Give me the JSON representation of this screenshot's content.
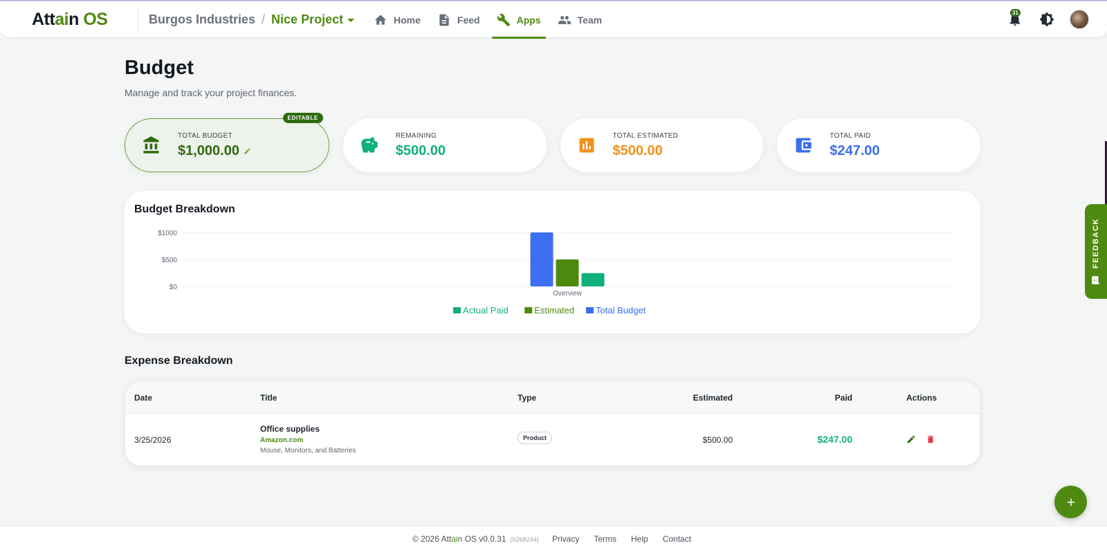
{
  "app": {
    "logo_prefix": "Att",
    "logo_accent": "ai",
    "logo_suffix": "n",
    "logo_os": "OS"
  },
  "breadcrumb": {
    "org": "Burgos Industries",
    "separator": "/",
    "project": "Nice Project"
  },
  "nav": {
    "home": "Home",
    "feed": "Feed",
    "apps": "Apps",
    "team": "Team"
  },
  "header": {
    "notifications_count": "31"
  },
  "page": {
    "title": "Budget",
    "subtitle": "Manage and track your project finances."
  },
  "cards": {
    "total_budget": {
      "label": "TOTAL BUDGET",
      "value": "$1,000.00",
      "badge": "EDITABLE",
      "color": "#2e6b0e",
      "icon": "bank-icon"
    },
    "remaining": {
      "label": "REMAINING",
      "value": "$500.00",
      "color": "#10b07a",
      "icon": "piggy-bank-icon"
    },
    "total_estimated": {
      "label": "TOTAL ESTIMATED",
      "value": "$500.00",
      "color": "#f2921c",
      "icon": "bar-chart-icon"
    },
    "total_paid": {
      "label": "TOTAL PAID",
      "value": "$247.00",
      "color": "#3b6ef0",
      "icon": "wallet-icon"
    }
  },
  "budget_breakdown": {
    "title": "Budget Breakdown"
  },
  "chart_data": {
    "type": "bar",
    "categories": [
      "Overview"
    ],
    "series": [
      {
        "name": "Total Budget",
        "values": [
          1000
        ],
        "color": "#3b6ef0"
      },
      {
        "name": "Estimated",
        "values": [
          500
        ],
        "color": "#4f8a10"
      },
      {
        "name": "Actual Paid",
        "values": [
          247
        ],
        "color": "#10b07a"
      }
    ],
    "legend_order": [
      "Actual Paid",
      "Estimated",
      "Total Budget"
    ],
    "y_ticks": [
      "$1000",
      "$500",
      "$0"
    ],
    "ylim": [
      0,
      1000
    ],
    "grid": true,
    "legend": "bottom-center"
  },
  "expenses": {
    "title": "Expense Breakdown",
    "columns": {
      "date": "Date",
      "title": "Title",
      "type": "Type",
      "estimated": "Estimated",
      "paid": "Paid",
      "actions": "Actions"
    },
    "rows": [
      {
        "date": "3/25/2026",
        "title": "Office supplies",
        "vendor": "Amazon.com",
        "description": "Mouse, Monitors, and Batteries",
        "type": "Product",
        "estimated": "$500.00",
        "paid": "$247.00"
      }
    ]
  },
  "feedback": {
    "label": "FEEDBACK"
  },
  "footer": {
    "copyright_prefix": "© 2026 Att",
    "copyright_accent": "ai",
    "copyright_suffix": "n OS v0.0.31",
    "build": "(b268244)",
    "links": [
      "Privacy",
      "Terms",
      "Help",
      "Contact"
    ]
  }
}
